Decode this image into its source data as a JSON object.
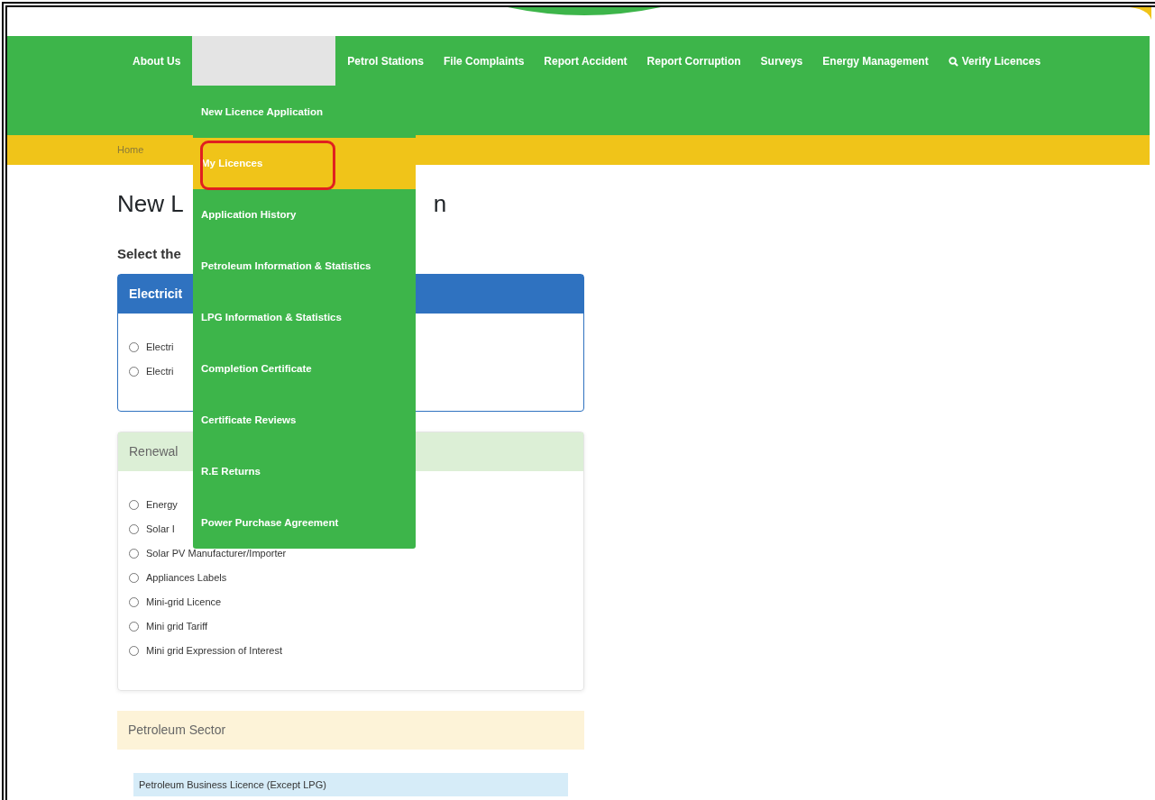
{
  "nav": {
    "items": [
      {
        "kind": "link",
        "label": "About Us"
      },
      {
        "kind": "dropdown",
        "expanded": true
      },
      {
        "kind": "link",
        "label": "Petrol Stations"
      },
      {
        "kind": "link",
        "label": "File Complaints"
      },
      {
        "kind": "link",
        "label": "Report Accident"
      },
      {
        "kind": "link",
        "label": "Report Corruption"
      },
      {
        "kind": "link",
        "label": "Surveys"
      },
      {
        "kind": "link",
        "label": "Energy Management"
      },
      {
        "kind": "search",
        "label": "Verify Licences"
      }
    ]
  },
  "dropdown_menu": [
    {
      "label": "New Licence Application",
      "selected": false,
      "circled": false
    },
    {
      "label": "My Licences",
      "selected": true,
      "circled": true
    },
    {
      "label": "Application History",
      "selected": false,
      "circled": false
    },
    {
      "label": "Petroleum Information & Statistics",
      "selected": false,
      "circled": false
    },
    {
      "label": "LPG Information & Statistics",
      "selected": false,
      "circled": false
    },
    {
      "label": "Completion Certificate",
      "selected": false,
      "circled": false
    },
    {
      "label": "Certificate Reviews",
      "selected": false,
      "circled": false
    },
    {
      "label": "R.E Returns",
      "selected": false,
      "circled": false
    },
    {
      "label": "Power Purchase Agreement",
      "selected": false,
      "circled": false
    }
  ],
  "breadcrumb": [
    "Home"
  ],
  "heading": [
    "New L",
    "n"
  ],
  "subheading": "Select the",
  "sections": [
    {
      "kind": "electricity",
      "title": "Electricit",
      "options": [
        {
          "label": "Electri",
          "checked": false
        },
        {
          "label": "Electri",
          "checked": false
        }
      ]
    },
    {
      "kind": "renewable",
      "title": "Renewal",
      "options": [
        {
          "label": "Energy",
          "checked": false
        },
        {
          "label": "Solar I",
          "checked": false
        },
        {
          "label": "Solar PV Manufacturer/Importer",
          "checked": false
        },
        {
          "label": "Appliances Labels",
          "checked": false
        },
        {
          "label": "Mini-grid Licence",
          "checked": false
        },
        {
          "label": "Mini grid Tariff",
          "checked": false
        },
        {
          "label": "Mini grid Expression of Interest",
          "checked": false
        }
      ]
    },
    {
      "kind": "petroleum",
      "title": "Petroleum Sector",
      "links": [
        "Petroleum Business Licence (Except LPG)"
      ]
    }
  ]
}
